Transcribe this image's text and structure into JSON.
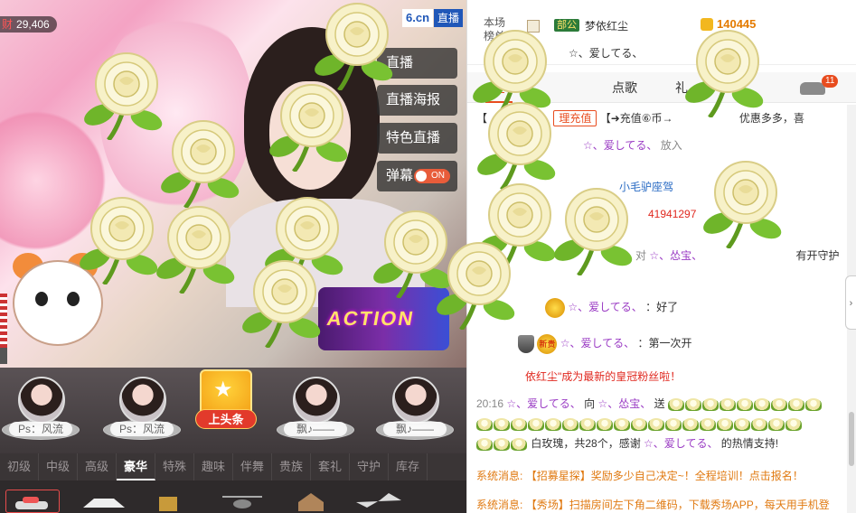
{
  "video": {
    "wealth_label": "财",
    "wealth_value": "29,406",
    "site_logo": "6.cn",
    "site_live": "直播",
    "danmu_toggle_state": "ON",
    "side_buttons": [
      {
        "label": "直播"
      },
      {
        "label": "直播海报"
      },
      {
        "label": "特色直播"
      },
      {
        "label": "弹幕"
      }
    ]
  },
  "guards": [
    {
      "name": "Ps：风流"
    },
    {
      "name": "Ps：风流"
    },
    {
      "name": "飘♪——"
    },
    {
      "name": "飘♪——"
    }
  ],
  "toutiao": {
    "label": "上头条"
  },
  "gift_tabs": [
    "初级",
    "中级",
    "高级",
    "豪华",
    "特殊",
    "趣味",
    "伴舞",
    "贵族",
    "套礼",
    "守护",
    "库存"
  ],
  "gift_tabs_active": "豪华",
  "rank": {
    "label": "本场榜单",
    "tag": "部公",
    "name": "梦依红尘",
    "score": "140445",
    "second": "☆、爱してる、"
  },
  "right_tabs": {
    "all": "全",
    "song": "点歌",
    "gift": "礼",
    "badge_count": "11"
  },
  "chat": {
    "line1_prefix": "【",
    "line1_btn": "理充值",
    "line1_text": "【➜充值⑥币→",
    "line1_tail": "优惠多多，喜",
    "line2_user": "☆、爱してる、",
    "line2_tail": "放入",
    "line3_seat": "小毛驴座驾",
    "line4_number": "41941297",
    "line5_pre": "对",
    "line5_user": "☆、怂宝、",
    "line5_tail": "有开守护",
    "line6_user": "☆、爱してる、",
    "line6_msg": "：好了",
    "line7_user": "☆、爱してる、",
    "line7_msg": "：第一次开",
    "medal_new": "新贵",
    "line8_text": "依红尘\"成为最新的皇冠粉丝啦！",
    "line9_time": "20:16",
    "line9_user": "☆、爱してる、",
    "line9_to": "向",
    "line9_target": "☆、怂宝、",
    "line9_send": "送",
    "line10_text": "白玫瑰，共28个，感谢",
    "line10_user": "☆、爱してる、",
    "line10_tail": "的热情支持!",
    "sys1_label": "系统消息:",
    "sys1_text": "【招募星探】奖励多少自己决定~！全程培训！点击报名！",
    "sys2_label": "系统消息:",
    "sys2_text": "【秀场】扫描房间左下角二维码，下载秀场APP，每天用手机登"
  }
}
